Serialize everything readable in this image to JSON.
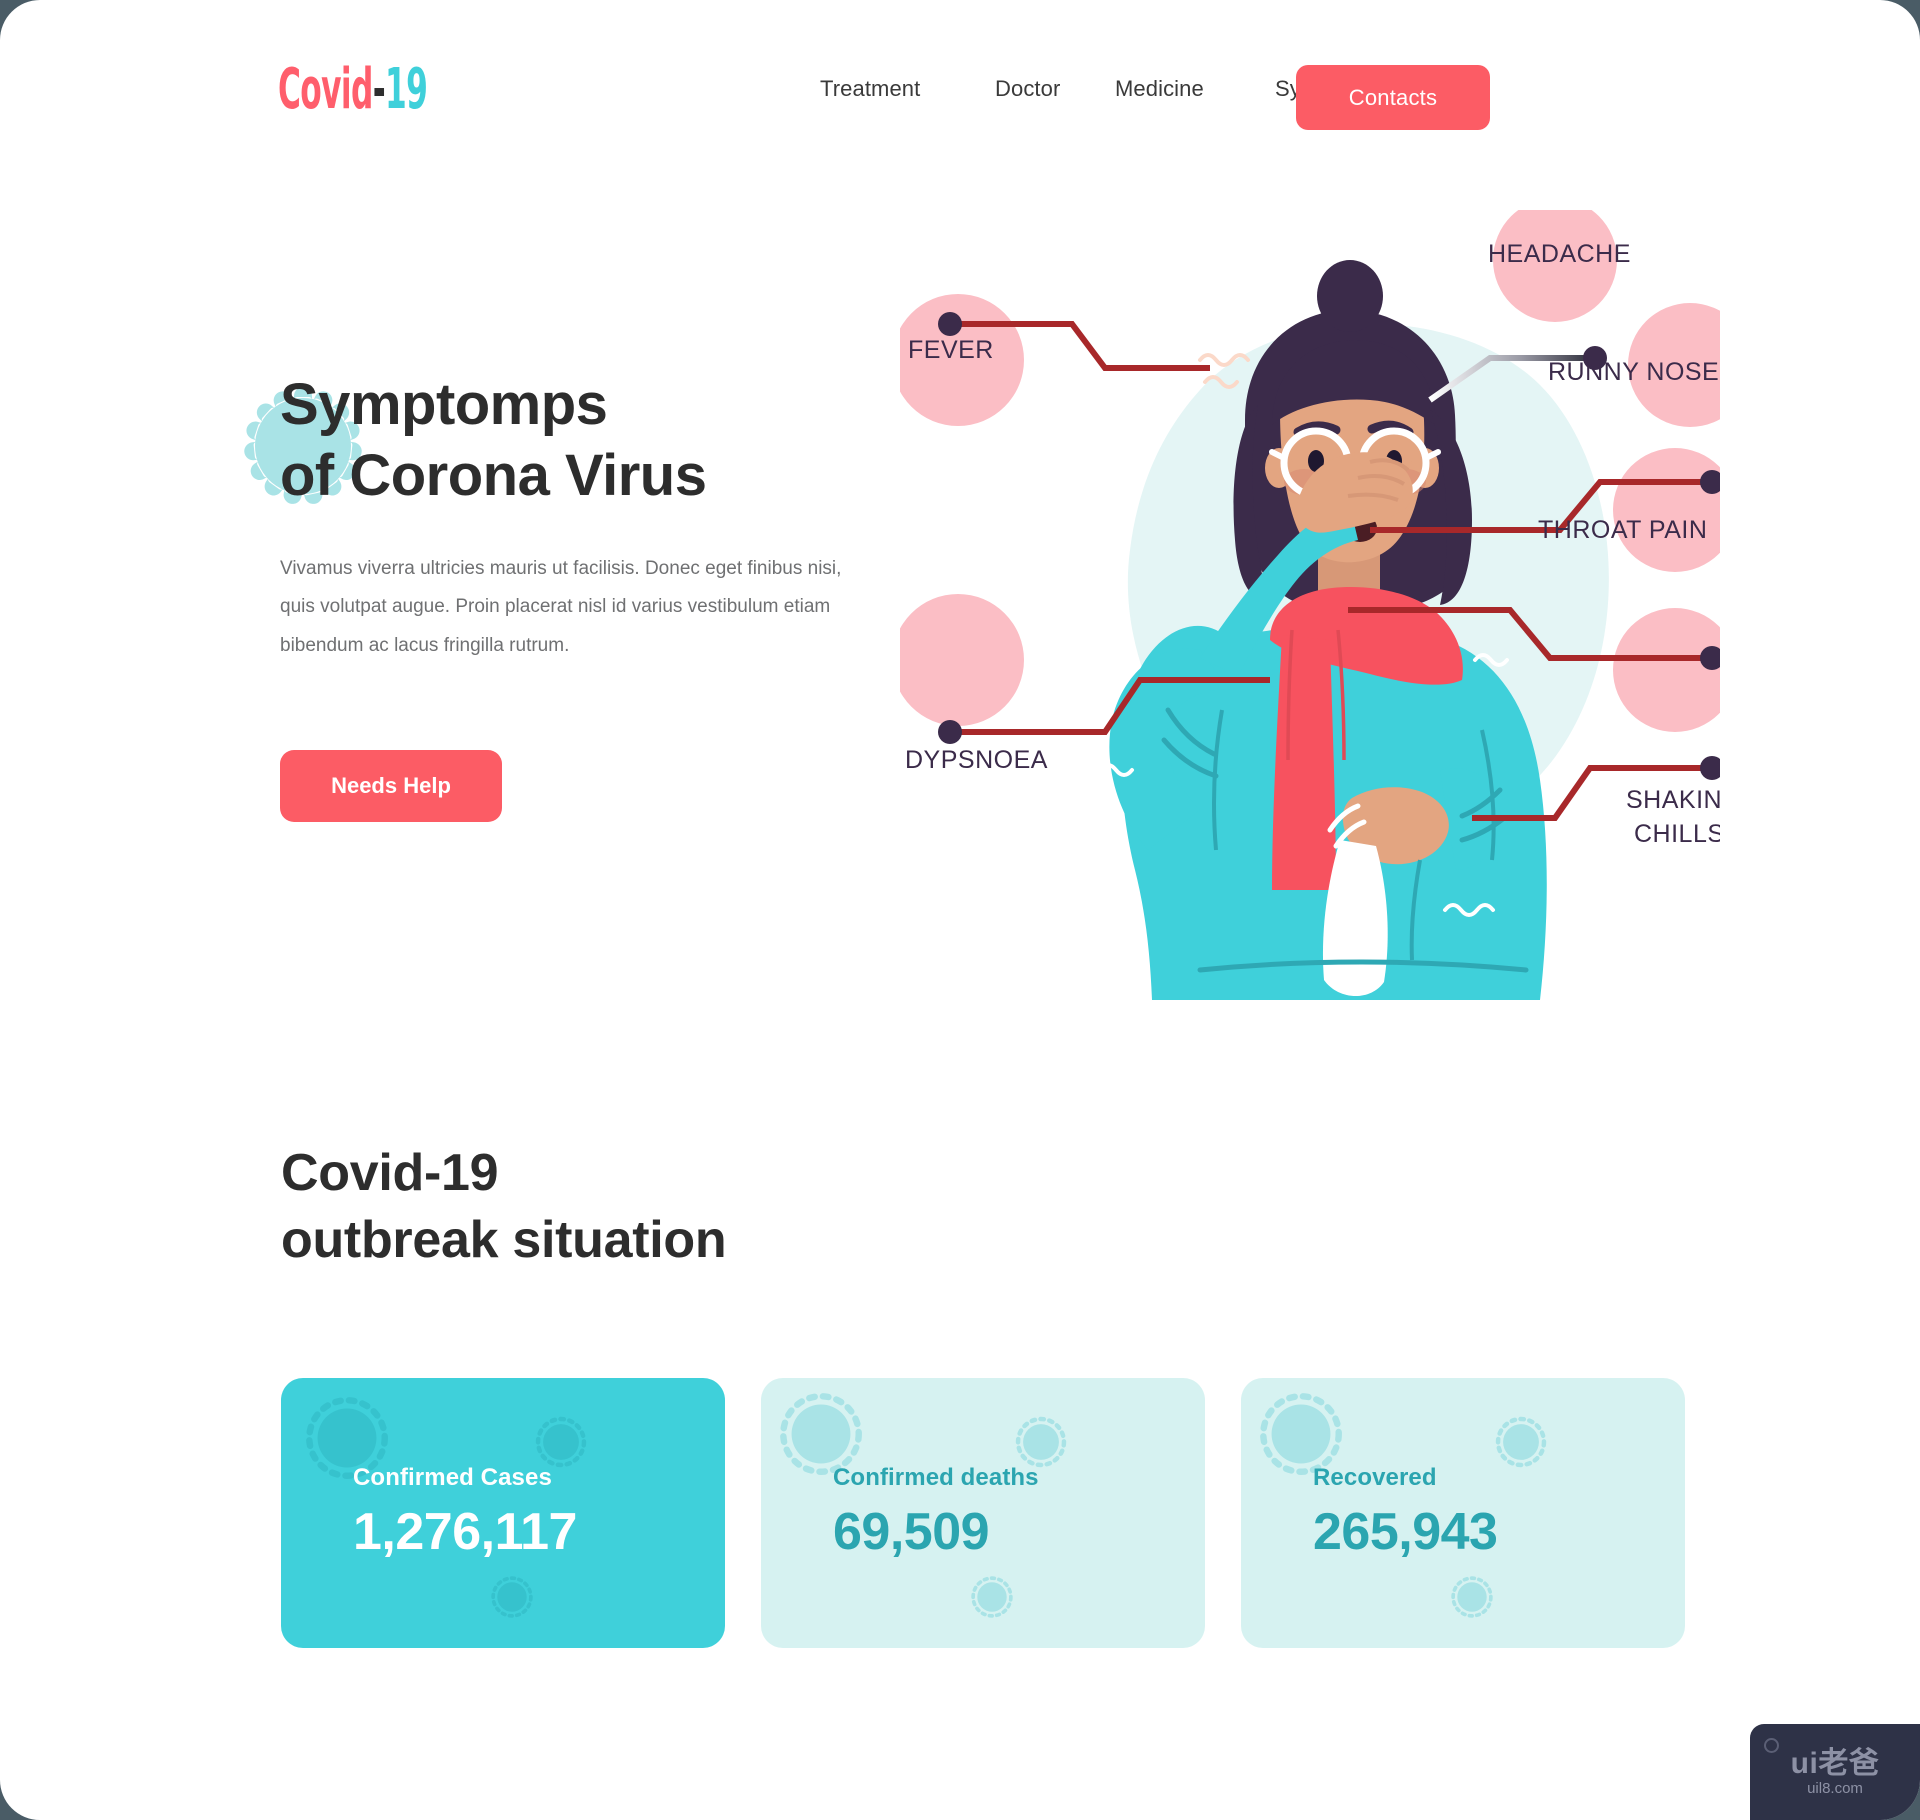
{
  "header": {
    "logo": {
      "part1": "Covid",
      "dash": "-",
      "part2": "19"
    },
    "nav": [
      {
        "label": "Treatment"
      },
      {
        "label": "Doctor"
      },
      {
        "label": "Medicine"
      },
      {
        "label": "Symptomps"
      }
    ],
    "contacts_label": "Contacts"
  },
  "hero": {
    "title_line1": "Symptomps",
    "title_line2": "of Corona Virus",
    "paragraph": "Vivamus viverra ultricies mauris ut facilisis. Donec eget finibus nisi, quis volutpat augue. Proin placerat nisl id varius vestibulum etiam bibendum ac lacus fringilla rutrum.",
    "cta_label": "Needs Help"
  },
  "illustration": {
    "alt": "woman-with-covid-symptoms-illustration",
    "symptoms": [
      {
        "label": "FEVER"
      },
      {
        "label": "HEADACHE"
      },
      {
        "label": "RUNNY NOSE"
      },
      {
        "label": "THROAT PAIN"
      },
      {
        "label": "DYPSNOEA"
      },
      {
        "label": "SHAKING"
      },
      {
        "label": "CHILLS"
      }
    ]
  },
  "outbreak": {
    "title_line1": "Covid-19",
    "title_line2": "outbreak situation",
    "cards": [
      {
        "label": "Confirmed Cases",
        "value": "1,276,117",
        "style": "solid"
      },
      {
        "label": "Confirmed deaths",
        "value": "69,509",
        "style": "light"
      },
      {
        "label": "Recovered",
        "value": "265,943",
        "style": "light"
      }
    ]
  },
  "watermark": {
    "main": "ui老爸",
    "sub": "uil8.com"
  },
  "colors": {
    "coral": "#FC5C65",
    "turquoise": "#3FD0DA",
    "card_light": "#D6F2F1",
    "card_text": "#2BA5B0",
    "pink_bubble": "#FBBEC5",
    "dark_ink": "#3B2B4A",
    "line_red": "#A8282A",
    "heading": "#2d2d2d",
    "body_text": "#6f7072",
    "page_backdrop": "#4a5c66"
  }
}
